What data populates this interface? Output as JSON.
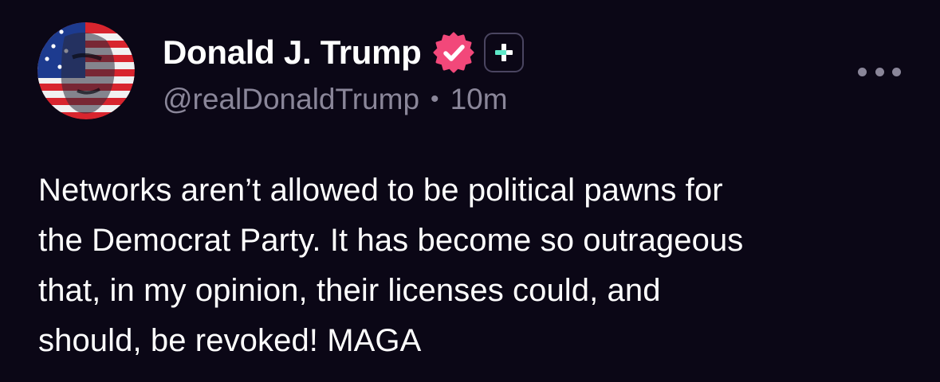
{
  "author": {
    "display_name": "Donald J. Trump",
    "handle": "@realDonaldTrump",
    "separator": "•",
    "time_ago": "10m",
    "verified": true
  },
  "post": {
    "text": "Networks aren’t allowed to be political pawns for\nthe Democrat Party. It has become so outrageous\nthat, in my opinion, their licenses could, and\nshould, be revoked! MAGA"
  },
  "icons": {
    "verified": "verified-badge-icon",
    "plus": "truth-plus-icon",
    "more": "more-options-icon"
  },
  "colors": {
    "background": "#0b0716",
    "verified_badge": "#f2487a",
    "plus_accent": "#5ee8c8",
    "secondary_text": "#8a8699"
  }
}
